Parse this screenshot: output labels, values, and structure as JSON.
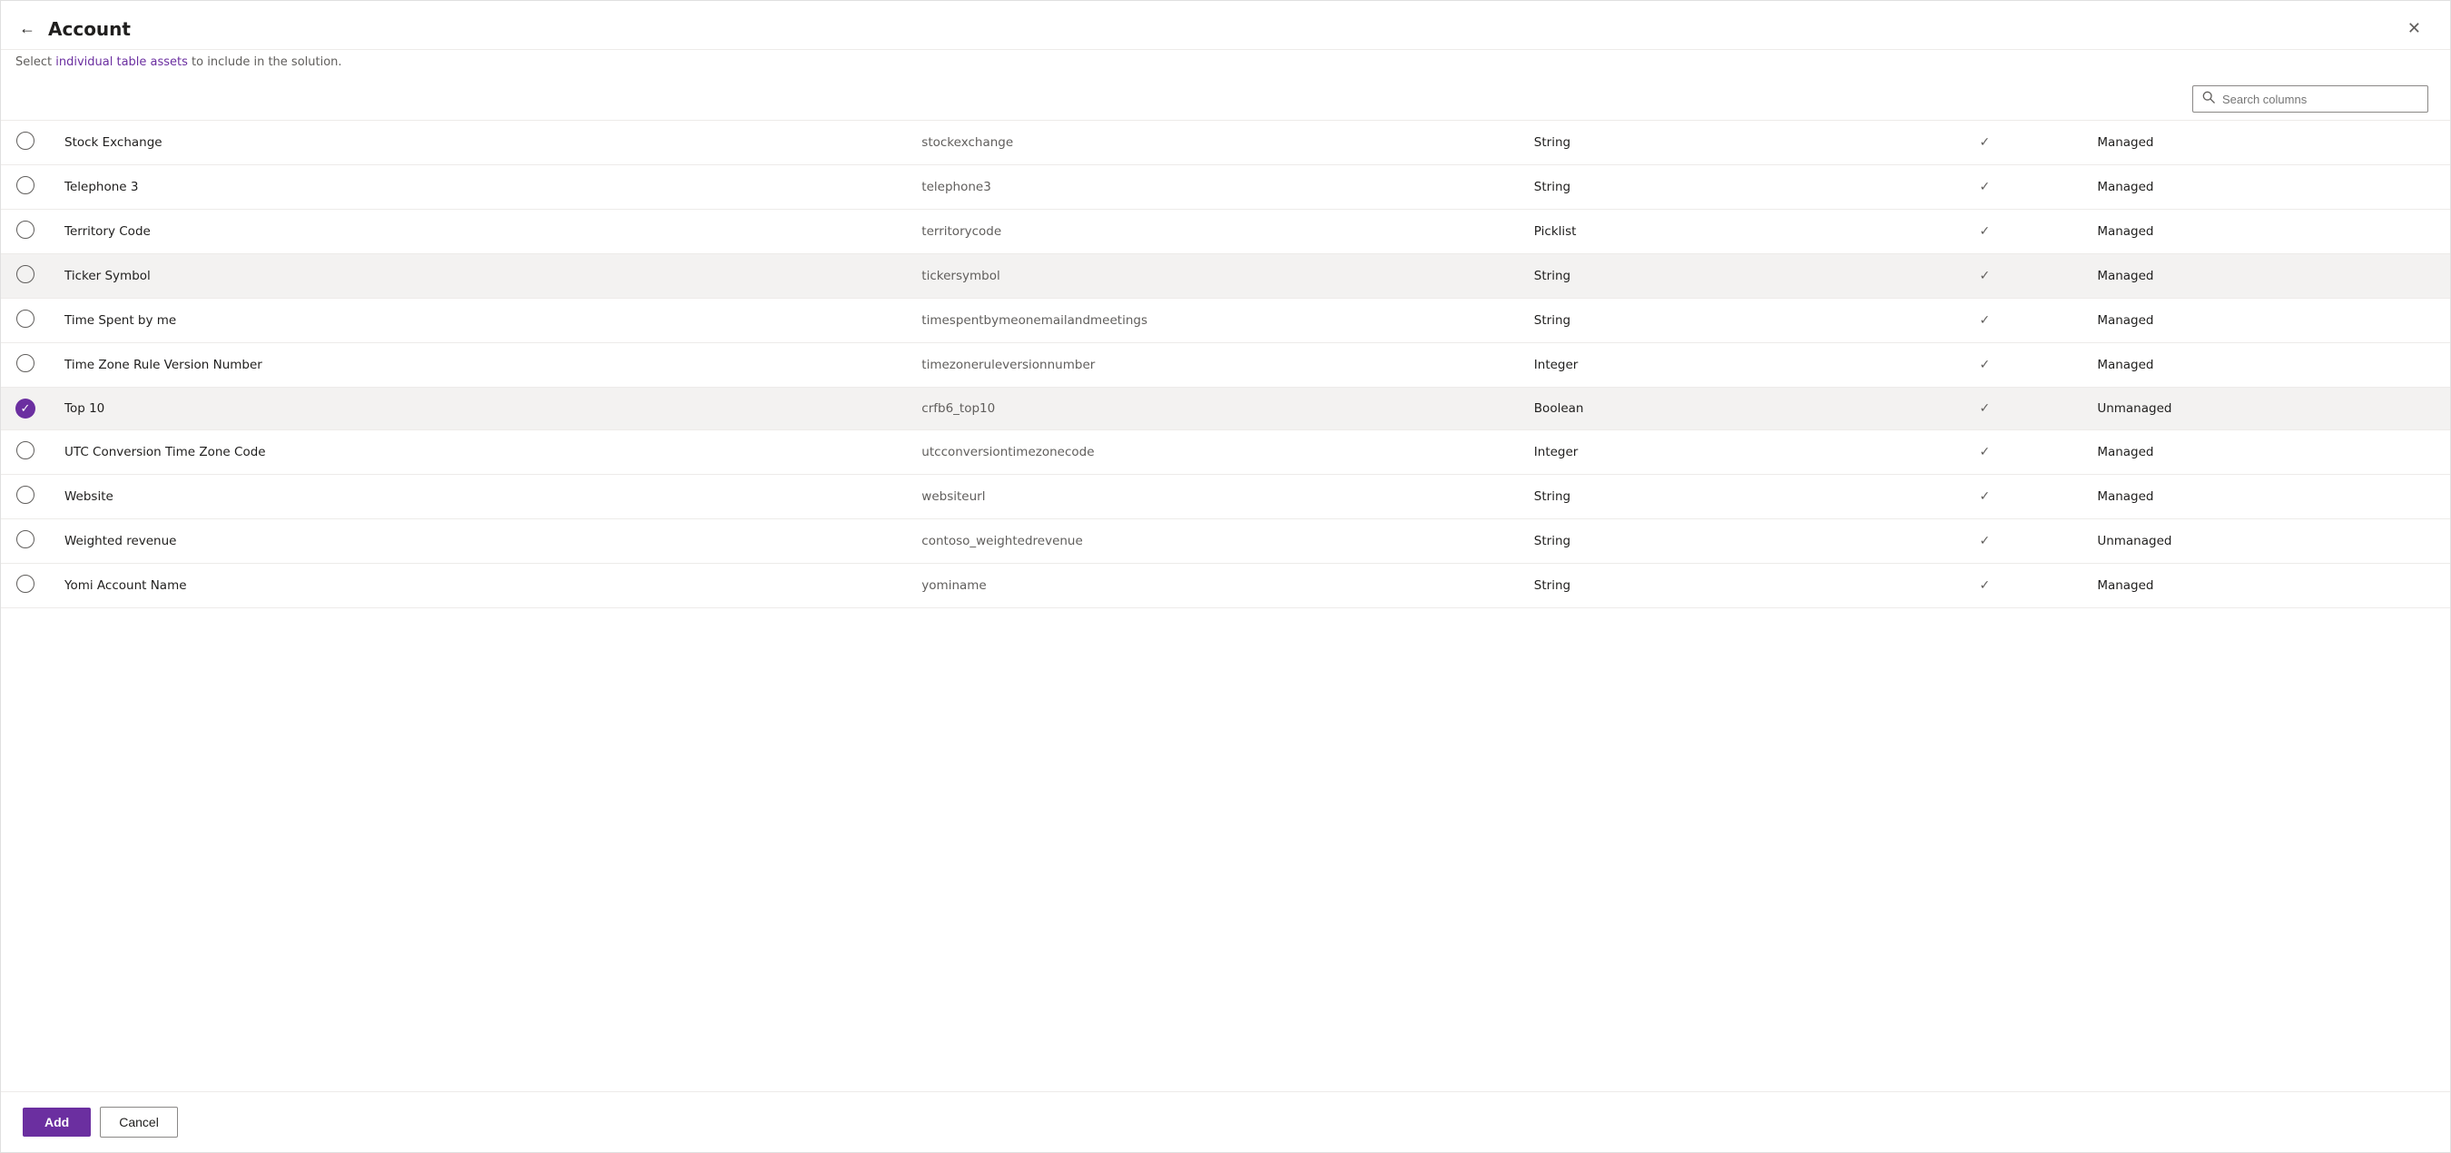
{
  "header": {
    "title": "Account",
    "subtitle_plain": "Select individual table assets to include in the solution.",
    "subtitle_highlight": "individual table assets",
    "subtitle_parts": {
      "before": "Select ",
      "highlight": "individual table assets",
      "after": " to include in the solution."
    },
    "back_label": "←",
    "close_label": "✕"
  },
  "search": {
    "placeholder": "Search columns",
    "value": ""
  },
  "buttons": {
    "add": "Add",
    "cancel": "Cancel"
  },
  "rows": [
    {
      "id": "stock-exchange",
      "selected": false,
      "name": "Stock Exchange",
      "logical": "stockexchange",
      "type": "String",
      "has_check": true,
      "managed": "Managed"
    },
    {
      "id": "telephone-3",
      "selected": false,
      "name": "Telephone 3",
      "logical": "telephone3",
      "type": "String",
      "has_check": true,
      "managed": "Managed"
    },
    {
      "id": "territory-code",
      "selected": false,
      "name": "Territory Code",
      "logical": "territorycode",
      "type": "Picklist",
      "has_check": true,
      "managed": "Managed"
    },
    {
      "id": "ticker-symbol",
      "selected": false,
      "name": "Ticker Symbol",
      "logical": "tickersymbol",
      "type": "String",
      "has_check": true,
      "managed": "Managed",
      "row_selected": true
    },
    {
      "id": "time-spent",
      "selected": false,
      "name": "Time Spent by me",
      "logical": "timespentbymeonemailandmeetings",
      "type": "String",
      "has_check": true,
      "managed": "Managed"
    },
    {
      "id": "timezone-rule",
      "selected": false,
      "name": "Time Zone Rule Version Number",
      "logical": "timezoneruleversionnumber",
      "type": "Integer",
      "has_check": true,
      "managed": "Managed"
    },
    {
      "id": "top-10",
      "selected": true,
      "name": "Top 10",
      "logical": "crfb6_top10",
      "type": "Boolean",
      "has_check": true,
      "managed": "Unmanaged",
      "row_selected": true
    },
    {
      "id": "utc-conversion",
      "selected": false,
      "name": "UTC Conversion Time Zone Code",
      "logical": "utcconversiontimezonecode",
      "type": "Integer",
      "has_check": true,
      "managed": "Managed"
    },
    {
      "id": "website",
      "selected": false,
      "name": "Website",
      "logical": "websiteurl",
      "type": "String",
      "has_check": true,
      "managed": "Managed"
    },
    {
      "id": "weighted-revenue",
      "selected": false,
      "name": "Weighted revenue",
      "logical": "contoso_weightedrevenue",
      "type": "String",
      "has_check": true,
      "managed": "Unmanaged"
    },
    {
      "id": "yomi-account",
      "selected": false,
      "name": "Yomi Account Name",
      "logical": "yominame",
      "type": "String",
      "has_check": true,
      "managed": "Managed"
    }
  ]
}
